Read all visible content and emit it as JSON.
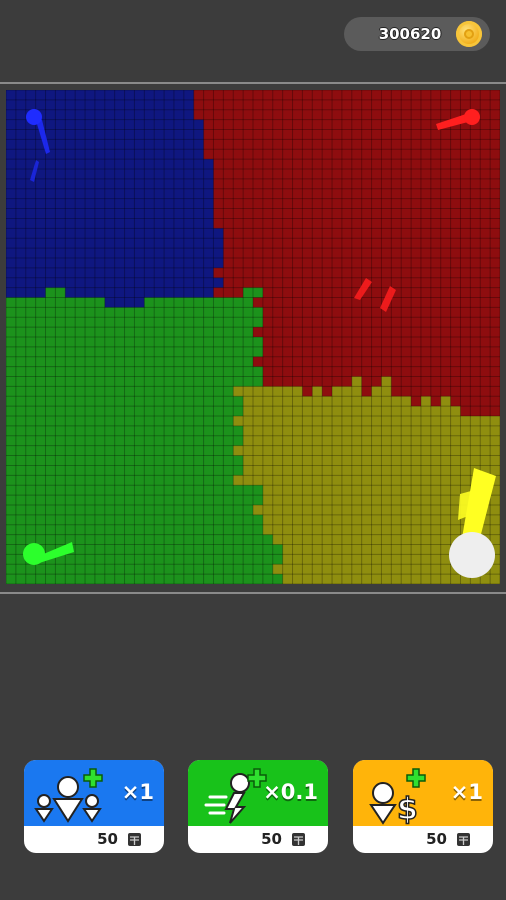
{
  "coins": {
    "value": "300620",
    "icon": "gold-coin-icon"
  },
  "arena": {
    "colors": {
      "blue": "#0f1780",
      "red": "#8e0d0f",
      "green": "#1c921c",
      "yellow": "#8f8e0f",
      "grid_line": "rgba(0,0,0,0.28)"
    },
    "players": [
      {
        "team": "blue",
        "color": "#1f2cff"
      },
      {
        "team": "red",
        "color": "#ff1f1f"
      },
      {
        "team": "green",
        "color": "#2cff2c"
      },
      {
        "team": "yellow",
        "color": "#ffff22"
      }
    ],
    "joystick": {
      "color": "#eeeeee"
    }
  },
  "upgrades": [
    {
      "id": "add-players",
      "icon": "add-players-icon",
      "multiplier": "×1",
      "cost": "50",
      "color": "#1a78f0"
    },
    {
      "id": "speed",
      "icon": "speed-icon",
      "multiplier": "×0.1",
      "cost": "50",
      "color": "#18c21a"
    },
    {
      "id": "income",
      "icon": "income-icon",
      "multiplier": "×1",
      "cost": "50",
      "color": "#ffb40a"
    }
  ]
}
